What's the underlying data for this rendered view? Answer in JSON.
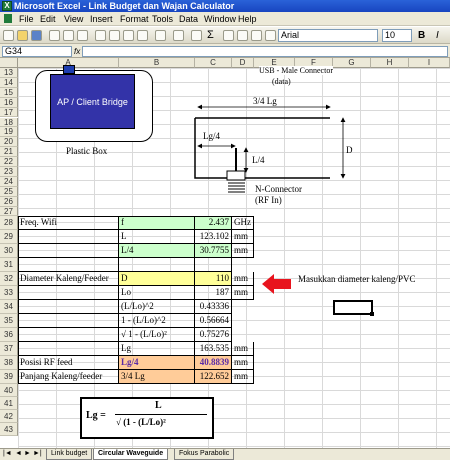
{
  "window": {
    "title": "Microsoft Excel - Link Budget dan Wajan Calculator"
  },
  "menu": [
    "File",
    "Edit",
    "View",
    "Insert",
    "Format",
    "Tools",
    "Data",
    "Window",
    "Help"
  ],
  "toolbar": {
    "font_name": "Arial",
    "font_size": "10",
    "bold": "B",
    "italic": "I"
  },
  "formula_bar": {
    "name_box": "G34",
    "fx": "fx",
    "value": ""
  },
  "columns": [
    "A",
    "B",
    "C",
    "D",
    "E",
    "F",
    "G",
    "H",
    "I"
  ],
  "rows": [
    "13",
    "14",
    "15",
    "16",
    "17",
    "18",
    "19",
    "20",
    "21",
    "22",
    "23",
    "24",
    "25",
    "26",
    "27",
    "28",
    "29",
    "30",
    "31",
    "32",
    "33",
    "34",
    "35",
    "36",
    "37",
    "38",
    "39",
    "40",
    "41",
    "42",
    "43"
  ],
  "drawing": {
    "ap_label": "AP / Client Bridge",
    "box_label": "Plastic Box",
    "usb_label": "USB - Male Connector",
    "usb_sub": "(data)",
    "dim_lg": "3/4 Lg",
    "dim_lg4": "Lg/4",
    "dim_l4": "L/4",
    "dim_d": "D",
    "nconn": "N-Connector",
    "rfin": "(RF In)"
  },
  "table": {
    "r28": {
      "a": "Freq. Wifi",
      "b": "f",
      "c": "2.437",
      "d": "GHz"
    },
    "r29": {
      "b": "L",
      "c": "123.102",
      "d": "mm"
    },
    "r30": {
      "b": "L/4",
      "c": "30.7755",
      "d": "mm"
    },
    "r32": {
      "a": "Diameter Kaleng/Feeder",
      "b": "D",
      "c": "110",
      "d": "mm"
    },
    "r33": {
      "b": "Lo",
      "c": "187",
      "d": "mm"
    },
    "r34": {
      "b": "(L/Lo)^2",
      "c": "0.43336"
    },
    "r35": {
      "b": "1 - (L/Lo)^2",
      "c": "0.56664"
    },
    "r36": {
      "b": "√ 1 - (L/Lo)²",
      "c": "0.75276"
    },
    "r37": {
      "b": "Lg",
      "c": "163.535",
      "d": "mm"
    },
    "r38": {
      "a": "Posisi RF feed",
      "b": "Lg/4",
      "c": "40.8839",
      "d": "mm"
    },
    "r39": {
      "a": "Panjang Kaleng/feeder",
      "b": "3/4 Lg",
      "c": "122.652",
      "d": "mm"
    }
  },
  "note": "Masukkan diameter kaleng/PVC",
  "formula_box": {
    "lhs": "Lg =",
    "num": "L",
    "den": "√ (1 -  (L/Lo)²"
  },
  "sheet_tabs": [
    "Link budget",
    "Circular Waveguide",
    "Fokus Parabolic"
  ],
  "active_tab": "Circular Waveguide",
  "colors": {
    "green": "#ccffcc",
    "yellow": "#ffff99",
    "orange": "#ffcc99",
    "arrow": "#e8141e",
    "titlebar": "#1f55cf"
  }
}
